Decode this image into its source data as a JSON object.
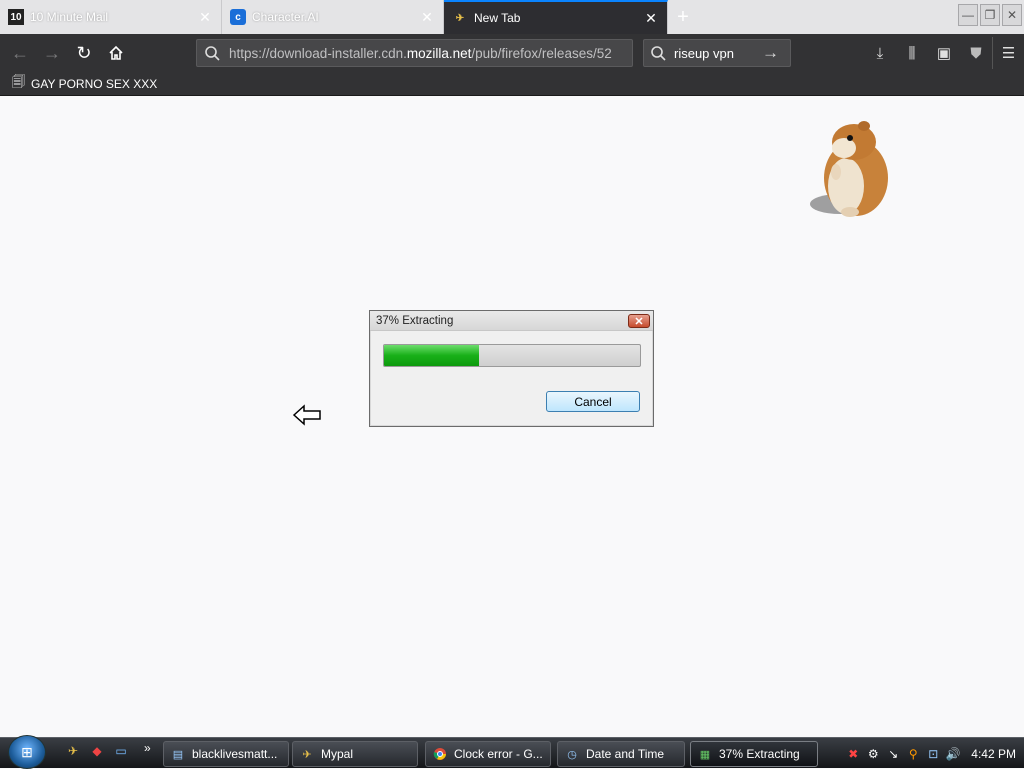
{
  "browser": {
    "tabs": [
      {
        "label": "10 Minute Mail",
        "icon": "ten-minute-mail-icon",
        "icon_glyph": "10"
      },
      {
        "label": "Character.AI",
        "icon": "character-ai-icon",
        "icon_glyph": "c"
      },
      {
        "label": "New Tab",
        "icon": "browser-logo-icon",
        "icon_glyph": "✈"
      }
    ],
    "new_tab_glyph": "+",
    "url": {
      "prefix": "https://download-installer.cdn.",
      "domain": "mozilla.net",
      "suffix": "/pub/firefox/releases/52"
    },
    "search": {
      "value": "riseup vpn"
    },
    "bookmark": {
      "label": "GAY PORNO SEX XXX"
    }
  },
  "dialog": {
    "title": "37% Extracting",
    "progress_percent": 37,
    "cancel_label": "Cancel",
    "close_glyph": "✕"
  },
  "taskbar": {
    "items": [
      {
        "label": "blacklivesmatt...",
        "icon": "document-icon"
      },
      {
        "label": "Mypal",
        "icon": "browser-logo-icon"
      },
      {
        "label": "Clock error - G...",
        "icon": "chrome-icon"
      },
      {
        "label": "Date and Time",
        "icon": "clock-settings-icon"
      },
      {
        "label": "37% Extracting",
        "icon": "installer-icon"
      }
    ],
    "clock": "4:42 PM"
  },
  "colors": {
    "accent": "#0a84ff",
    "progress_green": "#18b018",
    "dialog_close_red": "#c64b2d"
  }
}
